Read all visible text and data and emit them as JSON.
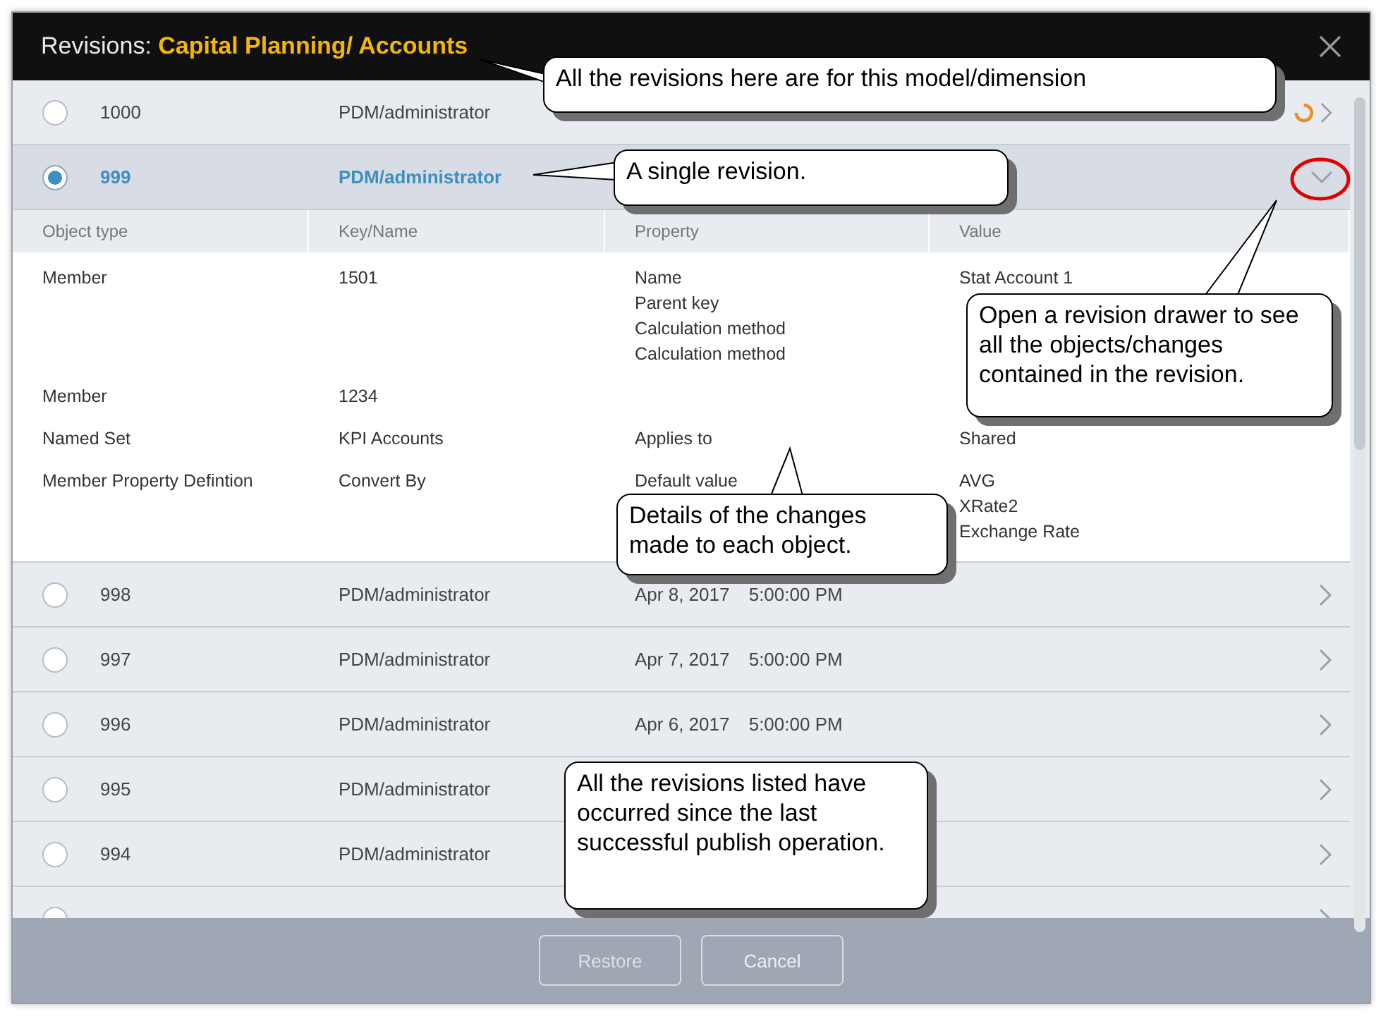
{
  "window": {
    "title_prefix": "Revisions:",
    "title_name": "Capital Planning/ Accounts"
  },
  "revisions": [
    {
      "id": "1000",
      "user": "PDM/administrator",
      "selected": false,
      "expanded": false,
      "busy": true
    },
    {
      "id": "999",
      "user": "PDM/administrator",
      "selected": true,
      "expanded": true,
      "busy": false,
      "details": {
        "columns": [
          "Object type",
          "Key/Name",
          "Property",
          "Value"
        ],
        "rows": [
          {
            "object_type": "Member",
            "key": "1501",
            "properties": [
              "Name",
              "Parent key",
              "Calculation method",
              "Calculation method"
            ],
            "values": [
              "Stat Account 1"
            ]
          },
          {
            "object_type": "Member",
            "key": "1234"
          },
          {
            "object_type": "Named Set",
            "key": "KPI Accounts",
            "properties": [
              "Applies to"
            ],
            "values": [
              "Shared"
            ]
          },
          {
            "object_type": "Member Property Defintion",
            "key": "Convert By",
            "properties": [
              "Default value"
            ],
            "values": [
              "AVG",
              "XRate2",
              "Exchange Rate"
            ]
          }
        ]
      }
    },
    {
      "id": "998",
      "user": "PDM/administrator",
      "date": "Apr 8, 2017",
      "time": "5:00:00 PM",
      "selected": false,
      "expanded": false,
      "busy": false
    },
    {
      "id": "997",
      "user": "PDM/administrator",
      "date": "Apr 7, 2017",
      "time": "5:00:00 PM",
      "selected": false,
      "expanded": false,
      "busy": false
    },
    {
      "id": "996",
      "user": "PDM/administrator",
      "date": "Apr 6, 2017",
      "time": "5:00:00 PM",
      "selected": false,
      "expanded": false,
      "busy": false
    },
    {
      "id": "995",
      "user": "PDM/administrator",
      "selected": false,
      "expanded": false,
      "busy": false
    },
    {
      "id": "994",
      "user": "PDM/administrator",
      "selected": false,
      "expanded": false,
      "busy": false
    },
    {
      "selected": false,
      "expanded": false,
      "busy": false
    }
  ],
  "buttons": [
    {
      "label": "Restore",
      "disabled": true
    },
    {
      "label": "Cancel",
      "disabled": false
    }
  ],
  "callouts": [
    {
      "text": "All the revisions here are for this model/dimension"
    },
    {
      "text": "A single revision."
    },
    {
      "text": "Open a revision drawer to see all the objects/changes contained in the revision."
    },
    {
      "text": "Details of the changes made to each object."
    },
    {
      "text": "All the revisions listed have occurred since the last successful publish operation."
    }
  ]
}
